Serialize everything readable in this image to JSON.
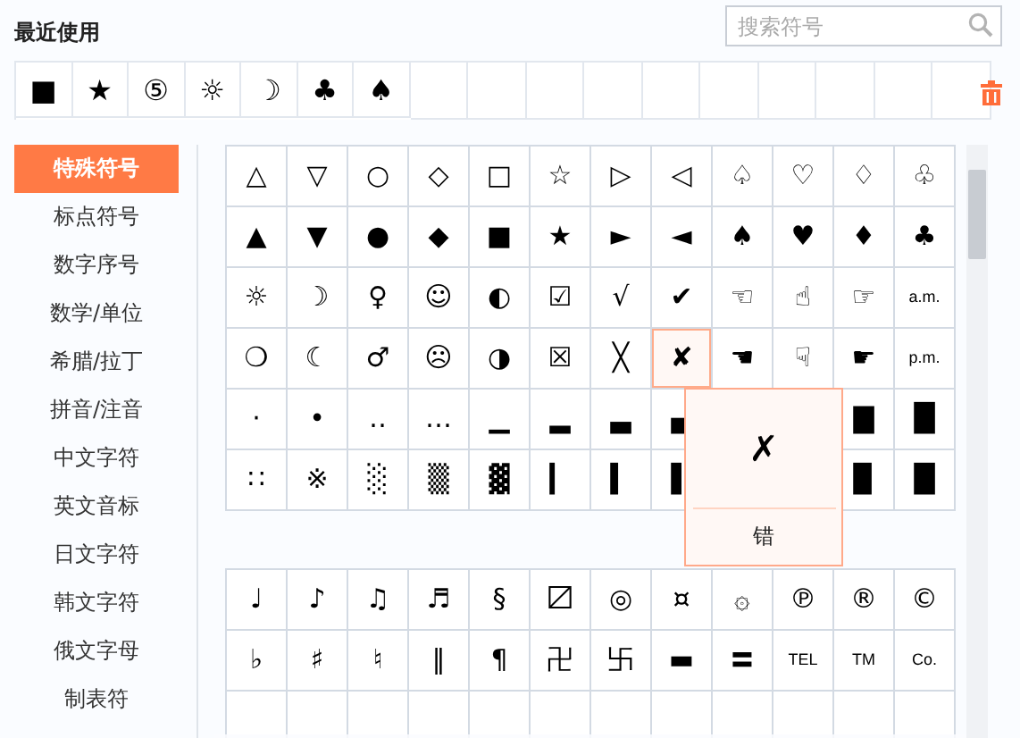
{
  "recent": {
    "title": "最近使用",
    "symbols": [
      "■",
      "★",
      "⑤",
      "☼",
      "☽",
      "♣",
      "♠"
    ]
  },
  "search": {
    "placeholder": "搜索符号"
  },
  "sidebar": {
    "items": [
      {
        "label": "特殊符号",
        "selected": true
      },
      {
        "label": "标点符号",
        "selected": false
      },
      {
        "label": "数字序号",
        "selected": false
      },
      {
        "label": "数学/单位",
        "selected": false
      },
      {
        "label": "希腊/拉丁",
        "selected": false
      },
      {
        "label": "拼音/注音",
        "selected": false
      },
      {
        "label": "中文字符",
        "selected": false
      },
      {
        "label": "英文音标",
        "selected": false
      },
      {
        "label": "日文字符",
        "selected": false
      },
      {
        "label": "韩文字符",
        "selected": false
      },
      {
        "label": "俄文字母",
        "selected": false
      },
      {
        "label": "制表符",
        "selected": false
      }
    ]
  },
  "grids": [
    {
      "rows": [
        [
          {
            "symbol": "△",
            "selected": false
          },
          {
            "symbol": "▽",
            "selected": false
          },
          {
            "symbol": "○",
            "selected": false
          },
          {
            "symbol": "◇",
            "selected": false
          },
          {
            "symbol": "□",
            "selected": false
          },
          {
            "symbol": "☆",
            "selected": false
          },
          {
            "symbol": "▷",
            "selected": false
          },
          {
            "symbol": "◁",
            "selected": false
          },
          {
            "symbol": "♤",
            "selected": false
          },
          {
            "symbol": "♡",
            "selected": false
          },
          {
            "symbol": "♢",
            "selected": false
          },
          {
            "symbol": "♧",
            "selected": false
          }
        ],
        [
          {
            "symbol": "▲",
            "selected": false
          },
          {
            "symbol": "▼",
            "selected": false
          },
          {
            "symbol": "●",
            "selected": false
          },
          {
            "symbol": "◆",
            "selected": false
          },
          {
            "symbol": "■",
            "selected": false
          },
          {
            "symbol": "★",
            "selected": false
          },
          {
            "symbol": "►",
            "selected": false
          },
          {
            "symbol": "◄",
            "selected": false
          },
          {
            "symbol": "♠",
            "selected": false
          },
          {
            "symbol": "♥",
            "selected": false
          },
          {
            "symbol": "♦",
            "selected": false
          },
          {
            "symbol": "♣",
            "selected": false
          }
        ],
        [
          {
            "symbol": "☼",
            "selected": false
          },
          {
            "symbol": "☽",
            "selected": false
          },
          {
            "symbol": "♀",
            "selected": false
          },
          {
            "symbol": "☺",
            "selected": false
          },
          {
            "symbol": "◐",
            "selected": false
          },
          {
            "symbol": "☑",
            "selected": false
          },
          {
            "symbol": "√",
            "selected": false
          },
          {
            "symbol": "✔",
            "selected": false
          },
          {
            "symbol": "☜",
            "selected": false
          },
          {
            "symbol": "☝",
            "selected": false
          },
          {
            "symbol": "☞",
            "selected": false
          },
          {
            "symbol": "a.m.",
            "selected": false
          }
        ],
        [
          {
            "symbol": "❍",
            "selected": false
          },
          {
            "symbol": "☾",
            "selected": false
          },
          {
            "symbol": "♂",
            "selected": false
          },
          {
            "symbol": "☹",
            "selected": false
          },
          {
            "symbol": "◑",
            "selected": false
          },
          {
            "symbol": "☒",
            "selected": false
          },
          {
            "symbol": "╳",
            "selected": false
          },
          {
            "symbol": "✘",
            "selected": true
          },
          {
            "symbol": "☚",
            "selected": false
          },
          {
            "symbol": "☟",
            "selected": false
          },
          {
            "symbol": "☛",
            "selected": false
          },
          {
            "symbol": "p.m.",
            "selected": false
          }
        ],
        [
          {
            "symbol": "·",
            "selected": false
          },
          {
            "symbol": "•",
            "selected": false
          },
          {
            "symbol": "‥",
            "selected": false
          },
          {
            "symbol": "…",
            "selected": false
          },
          {
            "symbol": "▁",
            "selected": false
          },
          {
            "symbol": "▂",
            "selected": false
          },
          {
            "symbol": "▃",
            "selected": false
          },
          {
            "symbol": "▄",
            "selected": false
          },
          null,
          null,
          {
            "symbol": "▇",
            "selected": false
          },
          {
            "symbol": "█",
            "selected": false
          }
        ],
        [
          {
            "symbol": "∷",
            "selected": false
          },
          {
            "symbol": "※",
            "selected": false
          },
          {
            "symbol": "░",
            "selected": false
          },
          {
            "symbol": "▒",
            "selected": false
          },
          {
            "symbol": "▓",
            "selected": false
          },
          {
            "symbol": "▎",
            "selected": false
          },
          {
            "symbol": "▍",
            "selected": false
          },
          {
            "symbol": "▌",
            "selected": false
          },
          null,
          null,
          {
            "symbol": "▉",
            "selected": false
          },
          {
            "symbol": "█",
            "selected": false
          }
        ]
      ],
      "popover": {
        "symbol": "✗",
        "meaning": "错"
      }
    },
    {
      "rows": [
        [
          {
            "symbol": "♩",
            "selected": false
          },
          {
            "symbol": "♪",
            "selected": false
          },
          {
            "symbol": "♫",
            "selected": false
          },
          {
            "symbol": "♬",
            "selected": false
          },
          {
            "symbol": "§",
            "selected": false
          },
          {
            "symbol": "〼",
            "selected": false
          },
          {
            "symbol": "◎",
            "selected": false
          },
          {
            "symbol": "¤",
            "selected": false
          },
          {
            "symbol": "۞",
            "selected": false
          },
          {
            "symbol": "℗",
            "selected": false
          },
          {
            "symbol": "®",
            "selected": false
          },
          {
            "symbol": "©",
            "selected": false
          }
        ],
        [
          {
            "symbol": "♭",
            "selected": false
          },
          {
            "symbol": "♯",
            "selected": false
          },
          {
            "symbol": "♮",
            "selected": false
          },
          {
            "symbol": "‖",
            "selected": false
          },
          {
            "symbol": "¶",
            "selected": false
          },
          {
            "symbol": "卍",
            "selected": false
          },
          {
            "symbol": "卐",
            "selected": false
          },
          {
            "symbol": "▬",
            "selected": false
          },
          {
            "symbol": "〓",
            "selected": false
          },
          {
            "symbol": "TEL",
            "selected": false
          },
          {
            "symbol": "TM",
            "selected": false
          },
          {
            "symbol": "Co.",
            "selected": false
          }
        ]
      ]
    }
  ]
}
